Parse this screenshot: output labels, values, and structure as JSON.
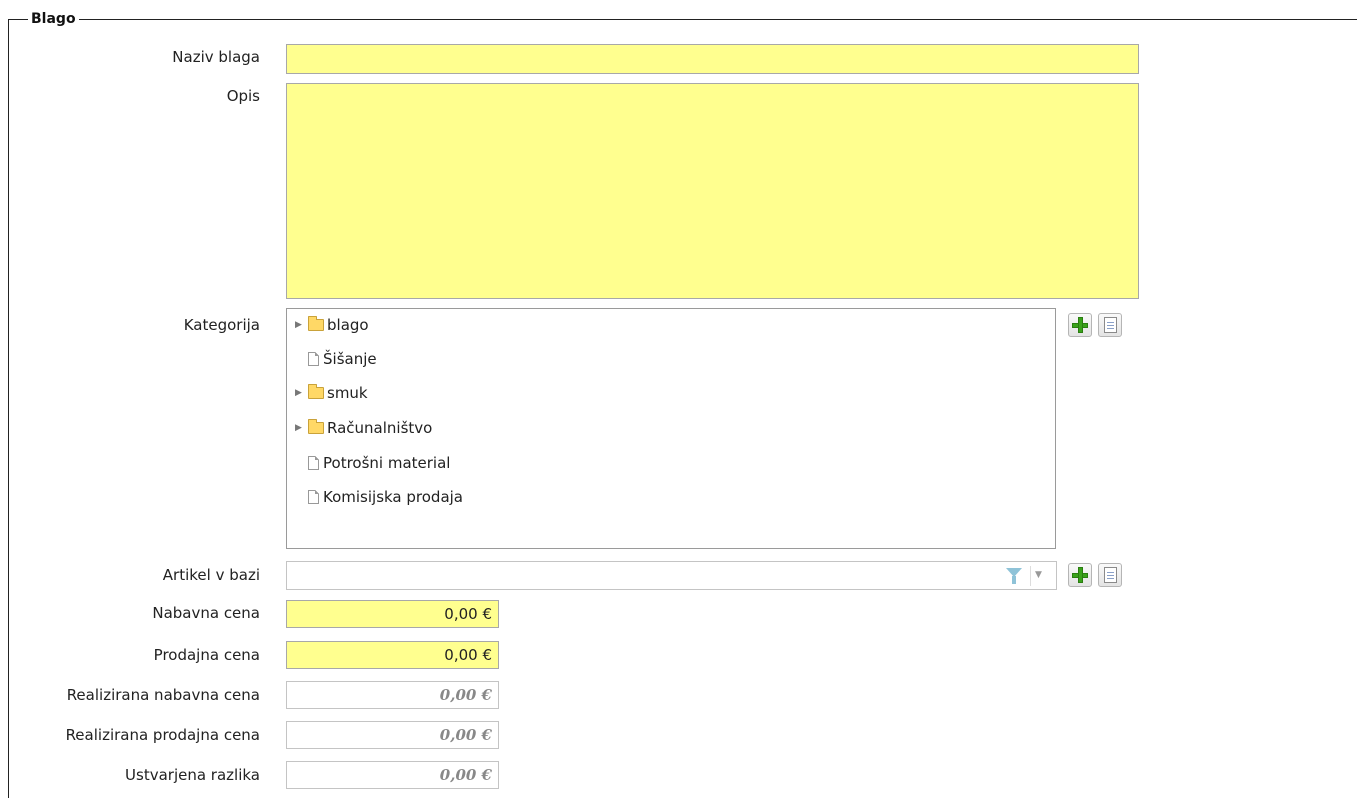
{
  "section": {
    "title": "Blago"
  },
  "fields": {
    "naziv_label": "Naziv blaga",
    "opis_label": "Opis",
    "kategorija_label": "Kategorija",
    "artikel_label": "Artikel v bazi",
    "nabavna_label": "Nabavna cena",
    "nabavna_value": "0,00 €",
    "prodajna_label": "Prodajna cena",
    "prodajna_value": "0,00 €",
    "real_nabavna_label": "Realizirana nabavna cena",
    "real_nabavna_value": "0,00 €",
    "real_prodajna_label": "Realizirana prodajna cena",
    "real_prodajna_value": "0,00 €",
    "razlika_label": "Ustvarjena razlika",
    "razlika_value": "0,00 €"
  },
  "tree": {
    "items": [
      {
        "label": "blago",
        "type": "folder",
        "expandable": true
      },
      {
        "label": "Šišanje",
        "type": "document",
        "expandable": false
      },
      {
        "label": "smuk",
        "type": "folder",
        "expandable": true
      },
      {
        "label": "Računalništvo",
        "type": "folder",
        "expandable": true
      },
      {
        "label": "Potrošni material",
        "type": "document",
        "expandable": false
      },
      {
        "label": "Komisijska prodaja",
        "type": "document",
        "expandable": false
      }
    ]
  },
  "icons": {
    "add": "plus-icon",
    "details": "document-icon",
    "filter": "filter-icon",
    "dropdown": "chevron-down-icon",
    "folder": "folder-icon",
    "expand": "triangle-right-icon"
  },
  "colors": {
    "required_field_bg": "#ffff8f",
    "add_icon": "#3aa31b"
  }
}
